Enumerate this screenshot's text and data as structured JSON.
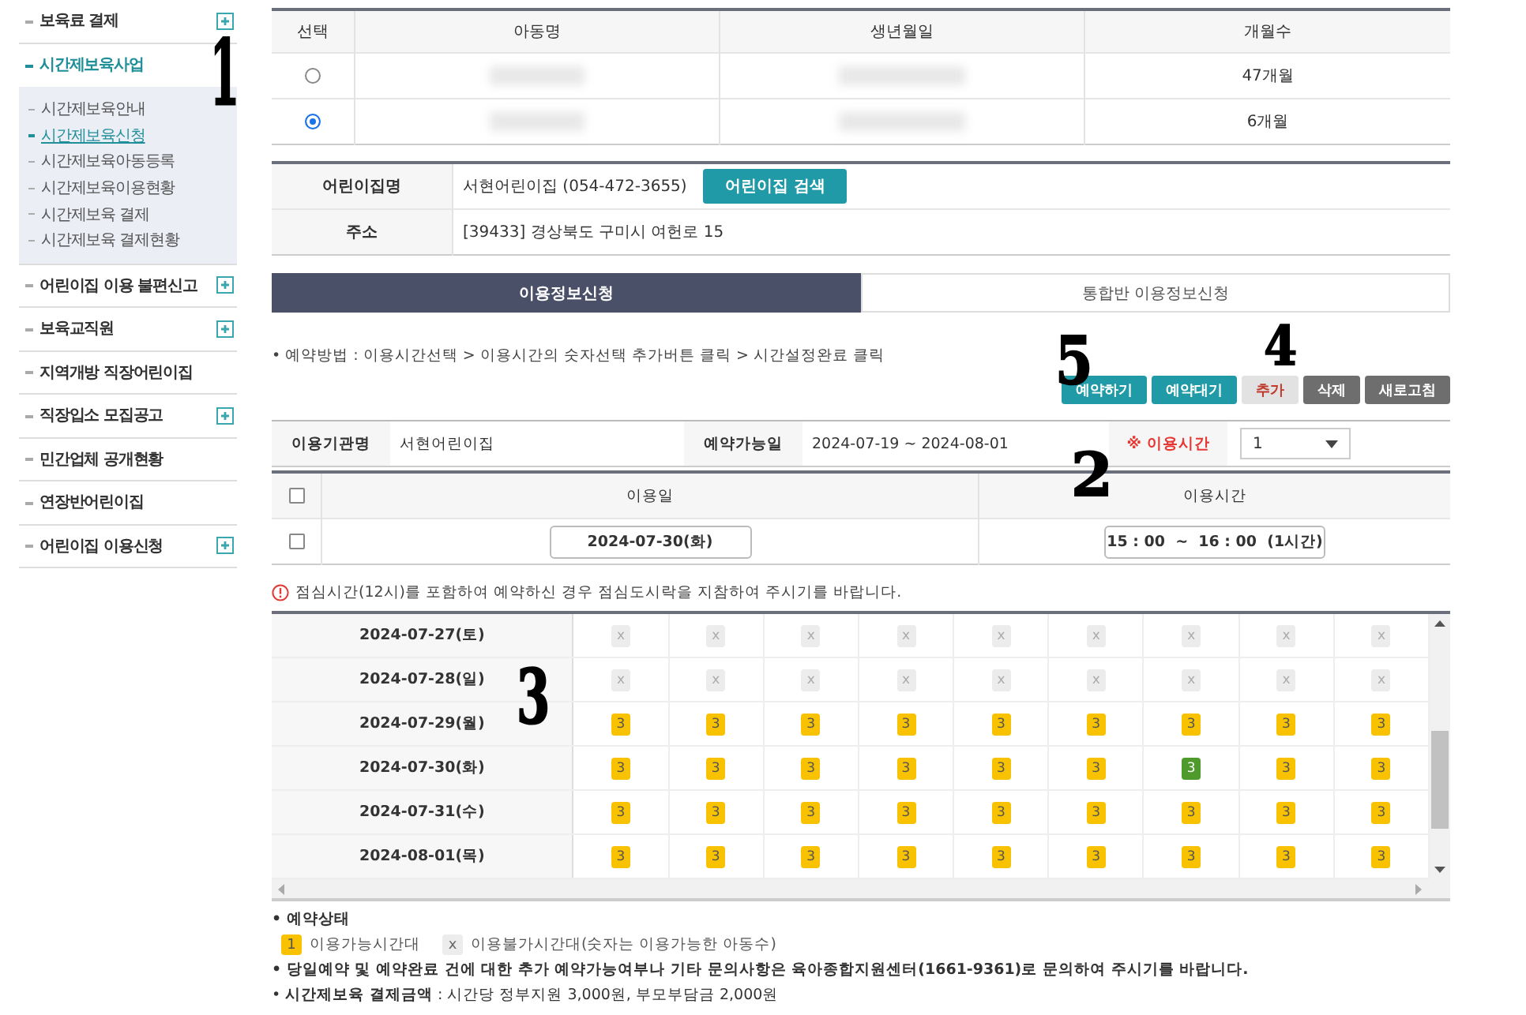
{
  "sidebar": {
    "items": [
      {
        "label": "보육료 결제",
        "has_submenu": true,
        "expanded": false,
        "selected": false
      },
      {
        "label": "시간제보육사업",
        "has_submenu": true,
        "expanded": true,
        "selected": true,
        "children": [
          {
            "label": "시간제보육안내",
            "selected": false
          },
          {
            "label": "시간제보육신청",
            "selected": true
          },
          {
            "label": "시간제보육아동등록",
            "selected": false
          },
          {
            "label": "시간제보육이용현황",
            "selected": false
          },
          {
            "label": "시간제보육 결제",
            "selected": false
          },
          {
            "label": "시간제보육 결제현황",
            "selected": false
          }
        ]
      },
      {
        "label": "어린이집 이용 불편신고",
        "has_submenu": true,
        "expanded": false,
        "selected": false
      },
      {
        "label": "보육교직원",
        "has_submenu": true,
        "expanded": false,
        "selected": false
      },
      {
        "label": "지역개방 직장어린이집",
        "has_submenu": false,
        "expanded": false,
        "selected": false
      },
      {
        "label": "직장입소 모집공고",
        "has_submenu": true,
        "expanded": false,
        "selected": false
      },
      {
        "label": "민간업체 공개현황",
        "has_submenu": false,
        "expanded": false,
        "selected": false
      },
      {
        "label": "연장반어린이집",
        "has_submenu": false,
        "expanded": false,
        "selected": false
      },
      {
        "label": "어린이집 이용신청",
        "has_submenu": true,
        "expanded": false,
        "selected": false
      }
    ]
  },
  "child_table": {
    "columns": [
      "선택",
      "아동명",
      "생년월일",
      "개월수"
    ],
    "rows": [
      {
        "selected": false,
        "months": "47개월"
      },
      {
        "selected": true,
        "months": "6개월"
      }
    ]
  },
  "center_info": {
    "rows": [
      {
        "label": "어린이집명",
        "value": "서현어린이집 (054-472-3655)",
        "button": "어린이집 검색"
      },
      {
        "label": "주소",
        "value": "[39433] 경상북도 구미시 여헌로 15"
      }
    ]
  },
  "tabs": [
    {
      "label": "이용정보신청",
      "selected": true
    },
    {
      "label": "통합반 이용정보신청",
      "selected": false
    }
  ],
  "guide": "• 예약방법 : 이용시간선택 > 이용시간의 숫자선택 추가버튼 클릭 > 시간설정완료 클릭",
  "buttons": [
    {
      "label": "예약하기",
      "kind": "primary"
    },
    {
      "label": "예약대기",
      "kind": "primary"
    },
    {
      "label": "추가",
      "kind": "light"
    },
    {
      "label": "삭제",
      "kind": "dark"
    },
    {
      "label": "새로고침",
      "kind": "dark"
    }
  ],
  "use_info": {
    "facility_label": "이용기관명",
    "facility": "서현어린이집",
    "period_label": "예약가능일",
    "period": "2024-07-19 ~ 2024-08-01",
    "hours_label": "※ 이용시간",
    "hours": "1"
  },
  "date_table": {
    "header_checked": false,
    "columns": [
      "이용일",
      "이용시간"
    ],
    "rows": [
      {
        "checked": false,
        "date": "2024-07-30(화)",
        "time": "15 : 00  ~  16 : 00  (1시간)"
      }
    ]
  },
  "warning": "점심시간(12시)를 포함하여 예약하신 경우 점심도시락을 지참하여 주시기를 바랍니다.",
  "schedule": {
    "rows": [
      {
        "date": "2024-07-27(토)",
        "slots": [
          {
            "text": "x",
            "kind": "unavailable"
          },
          {
            "text": "x",
            "kind": "unavailable"
          },
          {
            "text": "x",
            "kind": "unavailable"
          },
          {
            "text": "x",
            "kind": "unavailable"
          },
          {
            "text": "x",
            "kind": "unavailable"
          },
          {
            "text": "x",
            "kind": "unavailable"
          },
          {
            "text": "x",
            "kind": "unavailable"
          },
          {
            "text": "x",
            "kind": "unavailable"
          },
          {
            "text": "x",
            "kind": "unavailable"
          }
        ]
      },
      {
        "date": "2024-07-28(일)",
        "slots": [
          {
            "text": "x",
            "kind": "unavailable"
          },
          {
            "text": "x",
            "kind": "unavailable"
          },
          {
            "text": "x",
            "kind": "unavailable"
          },
          {
            "text": "x",
            "kind": "unavailable"
          },
          {
            "text": "x",
            "kind": "unavailable"
          },
          {
            "text": "x",
            "kind": "unavailable"
          },
          {
            "text": "x",
            "kind": "unavailable"
          },
          {
            "text": "x",
            "kind": "unavailable"
          },
          {
            "text": "x",
            "kind": "unavailable"
          }
        ]
      },
      {
        "date": "2024-07-29(월)",
        "slots": [
          {
            "text": "3",
            "kind": "available"
          },
          {
            "text": "3",
            "kind": "available"
          },
          {
            "text": "3",
            "kind": "available"
          },
          {
            "text": "3",
            "kind": "available"
          },
          {
            "text": "3",
            "kind": "available"
          },
          {
            "text": "3",
            "kind": "available"
          },
          {
            "text": "3",
            "kind": "available"
          },
          {
            "text": "3",
            "kind": "available"
          },
          {
            "text": "3",
            "kind": "available"
          }
        ]
      },
      {
        "date": "2024-07-30(화)",
        "slots": [
          {
            "text": "3",
            "kind": "available"
          },
          {
            "text": "3",
            "kind": "available"
          },
          {
            "text": "3",
            "kind": "available"
          },
          {
            "text": "3",
            "kind": "available"
          },
          {
            "text": "3",
            "kind": "available"
          },
          {
            "text": "3",
            "kind": "available"
          },
          {
            "text": "3",
            "kind": "selected"
          },
          {
            "text": "3",
            "kind": "available"
          },
          {
            "text": "3",
            "kind": "available"
          }
        ]
      },
      {
        "date": "2024-07-31(수)",
        "slots": [
          {
            "text": "3",
            "kind": "available"
          },
          {
            "text": "3",
            "kind": "available"
          },
          {
            "text": "3",
            "kind": "available"
          },
          {
            "text": "3",
            "kind": "available"
          },
          {
            "text": "3",
            "kind": "available"
          },
          {
            "text": "3",
            "kind": "available"
          },
          {
            "text": "3",
            "kind": "available"
          },
          {
            "text": "3",
            "kind": "available"
          },
          {
            "text": "3",
            "kind": "available"
          }
        ]
      },
      {
        "date": "2024-08-01(목)",
        "slots": [
          {
            "text": "3",
            "kind": "available"
          },
          {
            "text": "3",
            "kind": "available"
          },
          {
            "text": "3",
            "kind": "available"
          },
          {
            "text": "3",
            "kind": "available"
          },
          {
            "text": "3",
            "kind": "available"
          },
          {
            "text": "3",
            "kind": "available"
          },
          {
            "text": "3",
            "kind": "available"
          },
          {
            "text": "3",
            "kind": "available"
          },
          {
            "text": "3",
            "kind": "available"
          }
        ]
      }
    ]
  },
  "legend": {
    "title": "• 예약상태",
    "items": [
      {
        "badge": "1",
        "kind": "available",
        "label": "이용가능시간대"
      },
      {
        "badge": "x",
        "kind": "unavailable",
        "label": "이용불가시간대(숫자는 이용가능한 아동수)"
      }
    ]
  },
  "notes": [
    {
      "kind": "strong",
      "text": "• 당일예약 및 예약완료 건에 대한 추가 예약가능여부나 기타 문의사항은 육아종합지원센터(1661-9361)로 문의하여 주시기를 바랍니다."
    },
    {
      "kind": "plain",
      "text": "• **시간제보육 결제금액** : 시간당 정부지원 3,000원, 부모부담금 2,000원"
    }
  ],
  "annotations": [
    {
      "text": "1"
    },
    {
      "text": "4"
    },
    {
      "text": "5"
    },
    {
      "text": "2"
    },
    {
      "text": "3"
    }
  ]
}
